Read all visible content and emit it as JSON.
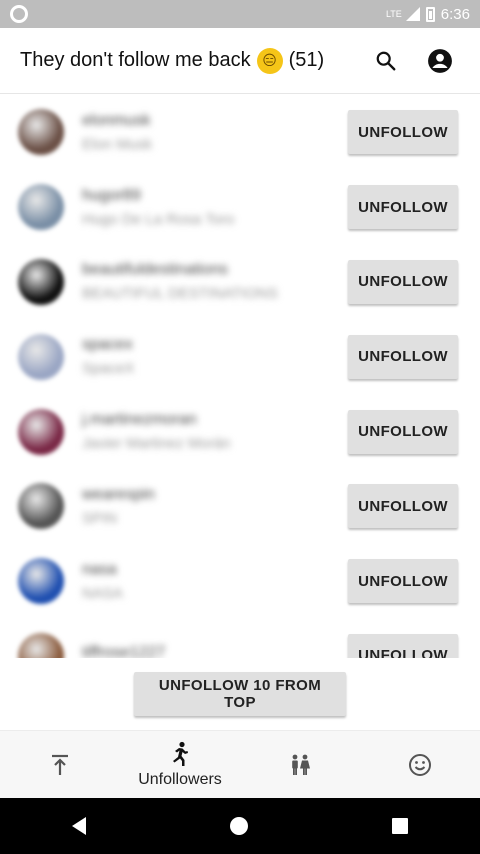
{
  "status_bar": {
    "time": "6:36",
    "network": "LTE"
  },
  "app_bar": {
    "title": "They don't follow me back",
    "emoji": "😑",
    "count": "(51)",
    "icons": [
      "search-icon",
      "account-circle-icon"
    ]
  },
  "unfollow_label": "UNFOLLOW",
  "list": [
    {
      "username": "elonmusk",
      "fullname": "Elon Musk",
      "avatar_color": "#6b5046"
    },
    {
      "username": "hugor89",
      "fullname": "Hugo De La Rosa Toro",
      "avatar_color": "#7a8fa6"
    },
    {
      "username": "beautifuldestinations",
      "fullname": "BEAUTIFUL DESTINATIONS",
      "avatar_color": "#111111"
    },
    {
      "username": "spacex",
      "fullname": "SpaceX",
      "avatar_color": "#9aa6c4"
    },
    {
      "username": "j.martinezmoran",
      "fullname": "Javier Martinez Morán",
      "avatar_color": "#7a2846"
    },
    {
      "username": "wearespin",
      "fullname": "SPIN",
      "avatar_color": "#555555"
    },
    {
      "username": "nasa",
      "fullname": "NASA",
      "avatar_color": "#1f4fb0"
    },
    {
      "username": "tiffrose1227",
      "fullname": "",
      "avatar_color": "#8a5a3c"
    }
  ],
  "bottom_action": {
    "label": "UNFOLLOW 10 FROM TOP"
  },
  "bottom_nav": {
    "items": [
      {
        "icon": "scroll-to-top-icon",
        "label": ""
      },
      {
        "icon": "running-person-icon",
        "label": "Unfollowers"
      },
      {
        "icon": "people-icon",
        "label": ""
      },
      {
        "icon": "smiley-icon",
        "label": ""
      }
    ],
    "active": 1
  }
}
